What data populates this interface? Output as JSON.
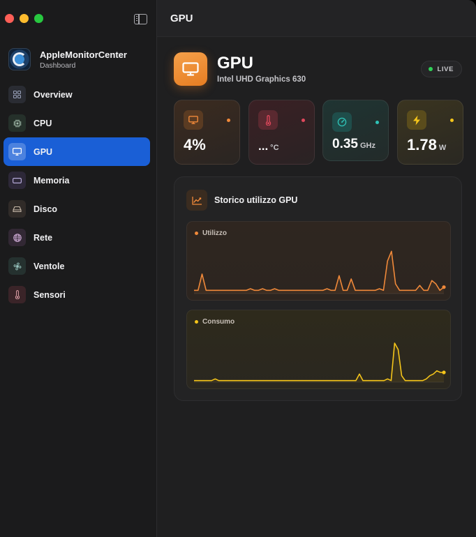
{
  "app": {
    "name": "AppleMonitorCenter",
    "subtitle": "Dashboard"
  },
  "sidebar": {
    "items": [
      {
        "label": "Overview",
        "icon": "grid-icon",
        "active": false
      },
      {
        "label": "CPU",
        "icon": "chip-icon",
        "active": false
      },
      {
        "label": "GPU",
        "icon": "display-icon",
        "active": true
      },
      {
        "label": "Memoria",
        "icon": "memory-icon",
        "active": false
      },
      {
        "label": "Disco",
        "icon": "drive-icon",
        "active": false
      },
      {
        "label": "Rete",
        "icon": "globe-icon",
        "active": false
      },
      {
        "label": "Ventole",
        "icon": "fan-icon",
        "active": false
      },
      {
        "label": "Sensori",
        "icon": "thermometer-icon",
        "active": false
      }
    ]
  },
  "titlebar": {
    "title": "GPU"
  },
  "header": {
    "title": "GPU",
    "subtitle": "Intel UHD Graphics 630",
    "live_label": "LIVE"
  },
  "stats": {
    "usage": {
      "value": "4%",
      "unit": "",
      "icon": "display-icon",
      "color": "#f0893a"
    },
    "temperature": {
      "value": "...",
      "unit": "°C",
      "icon": "thermometer-icon",
      "color": "#e0485c"
    },
    "frequency": {
      "value": "0.35",
      "unit": "GHz",
      "icon": "gauge-icon",
      "color": "#2fc4b8"
    },
    "power": {
      "value": "1.78",
      "unit": "W",
      "icon": "bolt-icon",
      "color": "#f5c51a"
    }
  },
  "history": {
    "title": "Storico utilizzo GPU",
    "icon": "chart-line-icon"
  },
  "chart_data": [
    {
      "type": "line",
      "title": "Utilizzo",
      "color": "#f0893a",
      "x": [
        1,
        2,
        3,
        4,
        5,
        6,
        7,
        8,
        9,
        10,
        11,
        12,
        13,
        14,
        15,
        16,
        17,
        18,
        19,
        20,
        21,
        22,
        23,
        24,
        25,
        26,
        27,
        28,
        29,
        30,
        31,
        32,
        33,
        34,
        35,
        36,
        37,
        38,
        39,
        40,
        41,
        42,
        43,
        44,
        45,
        46,
        47,
        48,
        49,
        50,
        51,
        52,
        53,
        54,
        55,
        56,
        57,
        58,
        59,
        60
      ],
      "values": [
        2,
        2,
        12,
        2,
        2,
        2,
        2,
        2,
        2,
        2,
        2,
        2,
        2,
        2,
        3,
        2,
        2,
        3,
        2,
        2,
        3,
        2,
        2,
        2,
        2,
        2,
        2,
        2,
        2,
        2,
        2,
        2,
        2,
        3,
        2,
        2,
        11,
        2,
        2,
        9,
        2,
        2,
        2,
        2,
        2,
        2,
        3,
        2,
        20,
        26,
        6,
        2,
        2,
        2,
        2,
        2,
        5,
        2,
        2,
        8,
        6,
        2,
        4
      ],
      "ylim": [
        0,
        100
      ]
    },
    {
      "type": "line",
      "title": "Consumo",
      "color": "#f5c51a",
      "values": [
        1,
        1,
        1,
        1,
        1,
        1,
        2,
        1,
        1,
        1,
        1,
        1,
        1,
        1,
        1,
        1,
        1,
        1,
        1,
        1,
        1,
        1,
        1,
        1,
        1,
        1,
        1,
        1,
        1,
        1,
        1,
        1,
        1,
        1,
        1,
        1,
        1,
        1,
        1,
        1,
        1,
        1,
        1,
        1,
        1,
        1,
        1,
        5,
        1,
        1,
        1,
        1,
        1,
        1,
        1,
        2,
        1,
        24,
        20,
        4,
        1,
        1,
        1,
        1,
        1,
        1,
        2,
        4,
        5,
        7,
        6,
        6
      ],
      "ylim": [
        0,
        100
      ]
    }
  ]
}
